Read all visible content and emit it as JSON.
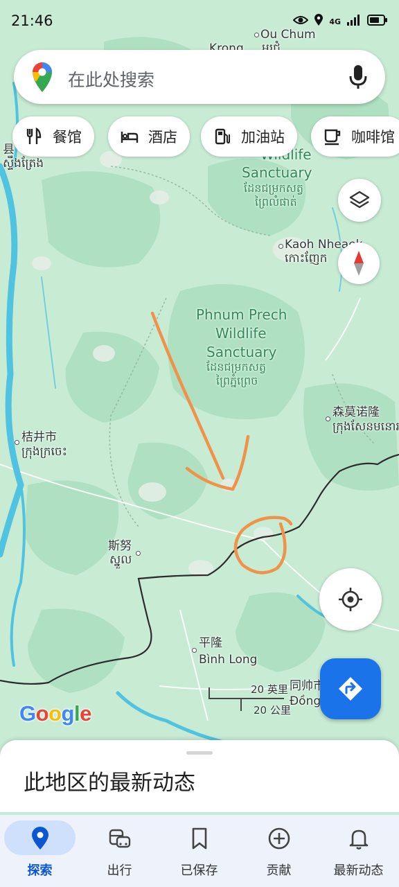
{
  "status_bar": {
    "time": "21:46",
    "network": "4G"
  },
  "search": {
    "placeholder": "在此处搜索"
  },
  "chips": [
    {
      "label": "餐馆",
      "icon": "restaurant-icon"
    },
    {
      "label": "酒店",
      "icon": "hotel-icon"
    },
    {
      "label": "加油站",
      "icon": "gas-station-icon"
    },
    {
      "label": "咖啡馆",
      "icon": "coffee-icon"
    }
  ],
  "map": {
    "labels": {
      "ou_chum": "Ou Chum",
      "krong": "Krong",
      "ou_chum_km": "អូរជុំ",
      "top_left_cn": "县",
      "top_left_km": "ស្ទឹងត្រែង",
      "wildlife_top": "Wildlife",
      "sanctuary_top": "Sanctuary",
      "sanctuary_top_km1": "ដែនជម្រកសត្វ",
      "sanctuary_top_km2": "ព្រៃលំផាត់",
      "kaoh_nheaek": "Kaoh Nheaek",
      "kaoh_nheaek_km": "កោះញែក",
      "phnum_prech_1": "Phnum Prech",
      "phnum_prech_2": "Wildlife",
      "phnum_prech_3": "Sanctuary",
      "phnum_prech_km1": "ដែនជម្រកសត្វ",
      "phnum_prech_km2": "ព្រៃភ្នំព្រេច",
      "sen_monorom_cn": "森莫诺隆",
      "sen_monorom_km": "ក្រុងសែនមនោរម",
      "kratie_cn": "桔井市",
      "kratie_km": "ក្រុងក្រចេះ",
      "snuol_cn": "斯努",
      "snuol_km": "ស្នួល",
      "binh_long_cn": "平隆",
      "binh_long": "Bình Long",
      "dong_xoai_cn": "同帅市",
      "dong_xoai": "Đồng"
    },
    "scale": {
      "miles": "20 英里",
      "km": "20 公里"
    },
    "logo": "Google"
  },
  "sheet": {
    "title": "此地区的最新动态"
  },
  "nav": [
    {
      "label": "探索",
      "icon": "explore-pin-icon",
      "active": true
    },
    {
      "label": "出行",
      "icon": "commute-icon",
      "active": false
    },
    {
      "label": "已保存",
      "icon": "bookmark-icon",
      "active": false
    },
    {
      "label": "贡献",
      "icon": "add-circle-icon",
      "active": false
    },
    {
      "label": "最新动态",
      "icon": "bell-icon",
      "active": false
    }
  ],
  "colors": {
    "map_base": "#c8ebd4",
    "map_forest": "#a9dfbc",
    "river": "#4fc3df",
    "border": "#2b2b2b",
    "annotation": "#f0934a",
    "accent": "#1a73e8"
  }
}
